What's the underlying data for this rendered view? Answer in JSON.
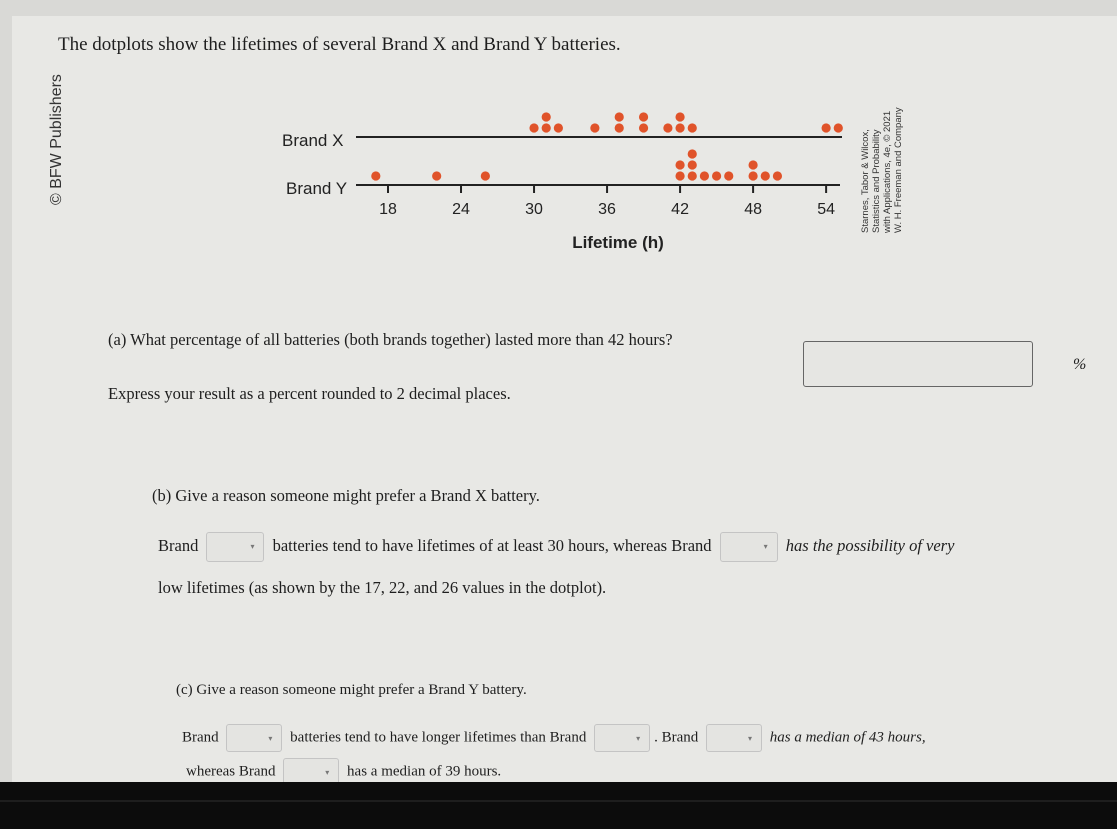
{
  "page": {
    "title": "The dotplots show the lifetimes of several Brand X and Brand Y batteries.",
    "publisher_note": "© BFW Publishers",
    "credit_lines": [
      "Starnes, Tabor & Wilcox,",
      "Statistics and Probability",
      "with Applications, 4e, © 2021",
      "W. H. Freeman and Company"
    ]
  },
  "chart_data": {
    "type": "scatter",
    "subtype": "dotplot",
    "xlabel": "Lifetime (h)",
    "ylabel": "",
    "xlim": [
      16,
      56
    ],
    "xticks": [
      18,
      24,
      30,
      36,
      42,
      48,
      54
    ],
    "tick_labels": [
      "18",
      "24",
      "30",
      "36",
      "42",
      "48",
      "54"
    ],
    "dot_color": "#e0532a",
    "series": [
      {
        "name": "Brand X",
        "values": [
          30,
          31,
          31,
          32,
          35,
          37,
          37,
          39,
          39,
          41,
          42,
          42,
          43,
          54,
          55
        ]
      },
      {
        "name": "Brand Y",
        "values": [
          17,
          22,
          26,
          42,
          42,
          43,
          43,
          43,
          44,
          45,
          46,
          48,
          48,
          49,
          50
        ]
      }
    ]
  },
  "part_a": {
    "question": "(a) What percentage of all batteries (both brands together) lasted more than 42 hours?",
    "instruction": "Express your result as a percent rounded to 2 decimal places.",
    "answer_value": "",
    "unit": "%"
  },
  "part_b": {
    "question": "(b) Give a reason someone might prefer a Brand X battery.",
    "text1": "Brand",
    "text2": "batteries tend to have lifetimes of at least 30 hours, whereas Brand",
    "text3": "has the possibility of very",
    "line2": "low lifetimes (as shown by the 17, 22, and 26 values in the dotplot).",
    "dropdown1_value": "",
    "dropdown2_value": ""
  },
  "part_c": {
    "question": "(c) Give a reason someone might prefer a Brand Y battery.",
    "text1": "Brand",
    "text2": "batteries tend to have longer lifetimes than Brand",
    "text3": ". Brand",
    "text4": "has a median of 43 hours,",
    "text5": "whereas Brand",
    "text6": "has a median of 39 hours.",
    "dropdown1_value": "",
    "dropdown2_value": "",
    "dropdown3_value": "",
    "dropdown4_value": ""
  },
  "icons": {
    "dropdown_caret": "▾"
  }
}
